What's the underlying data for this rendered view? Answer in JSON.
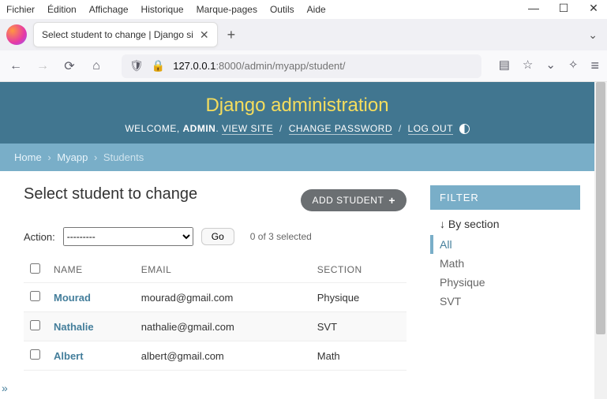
{
  "menubar": [
    "Fichier",
    "Édition",
    "Affichage",
    "Historique",
    "Marque-pages",
    "Outils",
    "Aide"
  ],
  "tab": {
    "title": "Select student to change | Django si"
  },
  "url": {
    "host": "127.0.0.1",
    "port": ":8000",
    "path": "/admin/myapp/student/"
  },
  "header": {
    "title": "Django administration",
    "welcome": "WELCOME, ",
    "user": "ADMIN",
    "view_site": "VIEW SITE",
    "change_password": "CHANGE PASSWORD",
    "logout": "LOG OUT"
  },
  "breadcrumbs": {
    "home": "Home",
    "app": "Myapp",
    "current": "Students"
  },
  "page": {
    "title": "Select student to change",
    "add_button": "ADD STUDENT",
    "action_label": "Action:",
    "action_placeholder": "---------",
    "go": "Go",
    "selection": "0 of 3 selected"
  },
  "columns": {
    "name": "NAME",
    "email": "EMAIL",
    "section": "SECTION"
  },
  "rows": [
    {
      "name": "Mourad",
      "email": "mourad@gmail.com",
      "section": "Physique"
    },
    {
      "name": "Nathalie",
      "email": "nathalie@gmail.com",
      "section": "SVT"
    },
    {
      "name": "Albert",
      "email": "albert@gmail.com",
      "section": "Math"
    }
  ],
  "filter": {
    "heading": "FILTER",
    "by_label": "↓ By section",
    "options": [
      "All",
      "Math",
      "Physique",
      "SVT"
    ],
    "selected": "All"
  }
}
